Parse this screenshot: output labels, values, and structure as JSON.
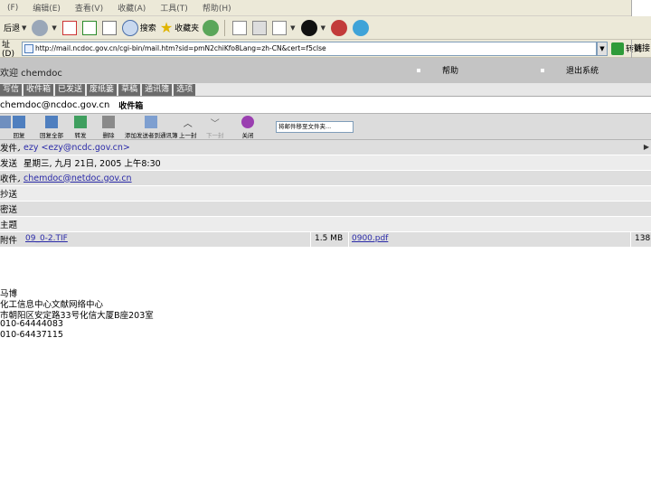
{
  "browser": {
    "menu": [
      "(F)",
      "编辑(E)",
      "查看(V)",
      "收藏(A)",
      "工具(T)",
      "帮助(H)"
    ],
    "toolbar": {
      "back_label": "后退",
      "search_label": "搜索",
      "favorites_label": "收藏夹"
    },
    "address_label": "址(D)",
    "url": "http://mail.ncdoc.gov.cn/cgi-bin/mail.htm?sid=pmN2chiKfo8Lang=zh-CN&cert=f5clse",
    "go_label": "转到",
    "links_label": "链接"
  },
  "mail": {
    "welcome": "欢迎 chemdoc",
    "help_link": "帮助",
    "logout_link": "退出系统",
    "nav": [
      "写信",
      "收件箱",
      "已发送",
      "废纸篓",
      "草稿",
      "通讯簿",
      "选项"
    ],
    "account": "chemdoc@ncdoc.gov.cn",
    "current_folder": "收件箱",
    "actions": [
      "回复",
      "回复全部",
      "转发",
      "删除",
      "添加发送者到通讯簿",
      "上一封",
      "下一封",
      "关闭"
    ],
    "move_select": "将邮件移至文件夹..."
  },
  "message": {
    "headers": [
      {
        "label": "发件人",
        "value": "ezy <ezy@ncdc.gov.cn>"
      },
      {
        "label": "发送",
        "value": "星期三, 九月 21日, 2005 上午8:30"
      },
      {
        "label": "收件人",
        "value": "chemdoc@netdoc.gov.cn"
      },
      {
        "label": "抄送",
        "value": ""
      },
      {
        "label": "密送",
        "value": ""
      },
      {
        "label": "主题",
        "value": ""
      }
    ],
    "attachments_label": "附件",
    "attachments": [
      {
        "name": "09_0-2.TIF",
        "size": "1.5 MB"
      },
      {
        "name": "0900.pdf",
        "size": "138"
      }
    ],
    "body": [
      "马博",
      "化工信息中心文献网络中心",
      "市朝阳区安定路33号化信大厦B座203室",
      "010-64444083",
      "010-64437115"
    ]
  }
}
